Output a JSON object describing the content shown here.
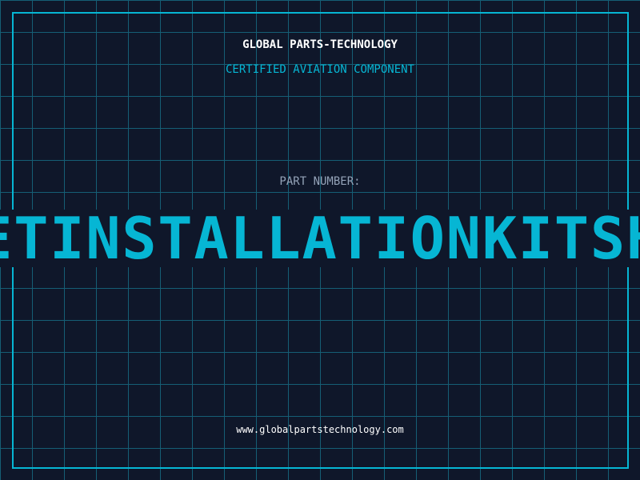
{
  "header": {
    "company": "GLOBAL PARTS-TECHNOLOGY",
    "subtitle": "CERTIFIED AVIATION COMPONENT"
  },
  "part": {
    "label": "PART NUMBER:",
    "value": "ETINSTALLATIONKITSH"
  },
  "footer": {
    "url": "www.globalpartstechnology.com"
  },
  "colors": {
    "background": "#0f172a",
    "grid": "#155e75",
    "accent": "#06b6d4",
    "label": "#94a3b8",
    "title": "#ffffff"
  }
}
